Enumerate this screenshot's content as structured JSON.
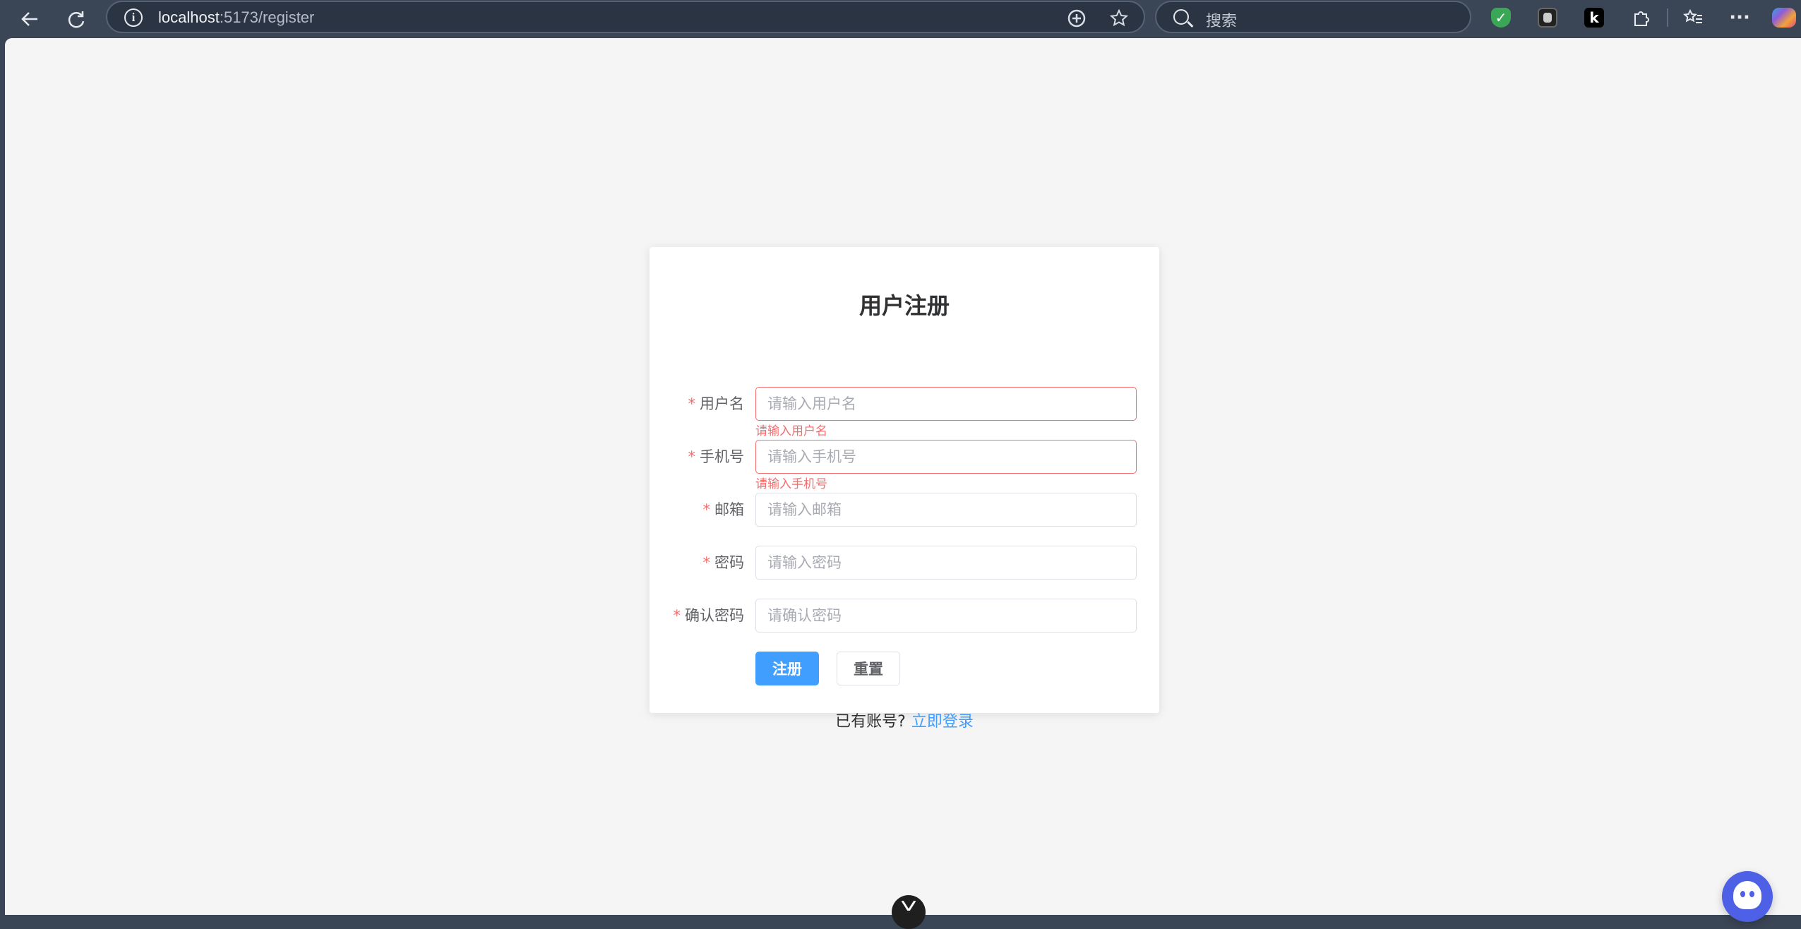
{
  "browser": {
    "url_host": "localhost",
    "url_path": ":5173/register",
    "search_placeholder": "搜索",
    "extensions": [
      "shield-check",
      "ghost",
      "k",
      "puzzle"
    ]
  },
  "form": {
    "title": "用户注册",
    "required_mark": "*",
    "fields": [
      {
        "label": "用户名",
        "placeholder": "请输入用户名",
        "error": "请输入用户名"
      },
      {
        "label": "手机号",
        "placeholder": "请输入手机号",
        "error": "请输入手机号"
      },
      {
        "label": "邮箱",
        "placeholder": "请输入邮箱",
        "error": ""
      },
      {
        "label": "密码",
        "placeholder": "请输入密码",
        "error": ""
      },
      {
        "label": "确认密码",
        "placeholder": "请确认密码",
        "error": ""
      }
    ],
    "submit_label": "注册",
    "reset_label": "重置",
    "footer_text": "已有账号?",
    "login_link": "立即登录"
  },
  "colors": {
    "primary": "#409eff",
    "danger": "#f56c6c",
    "chrome": "#3a4556"
  }
}
